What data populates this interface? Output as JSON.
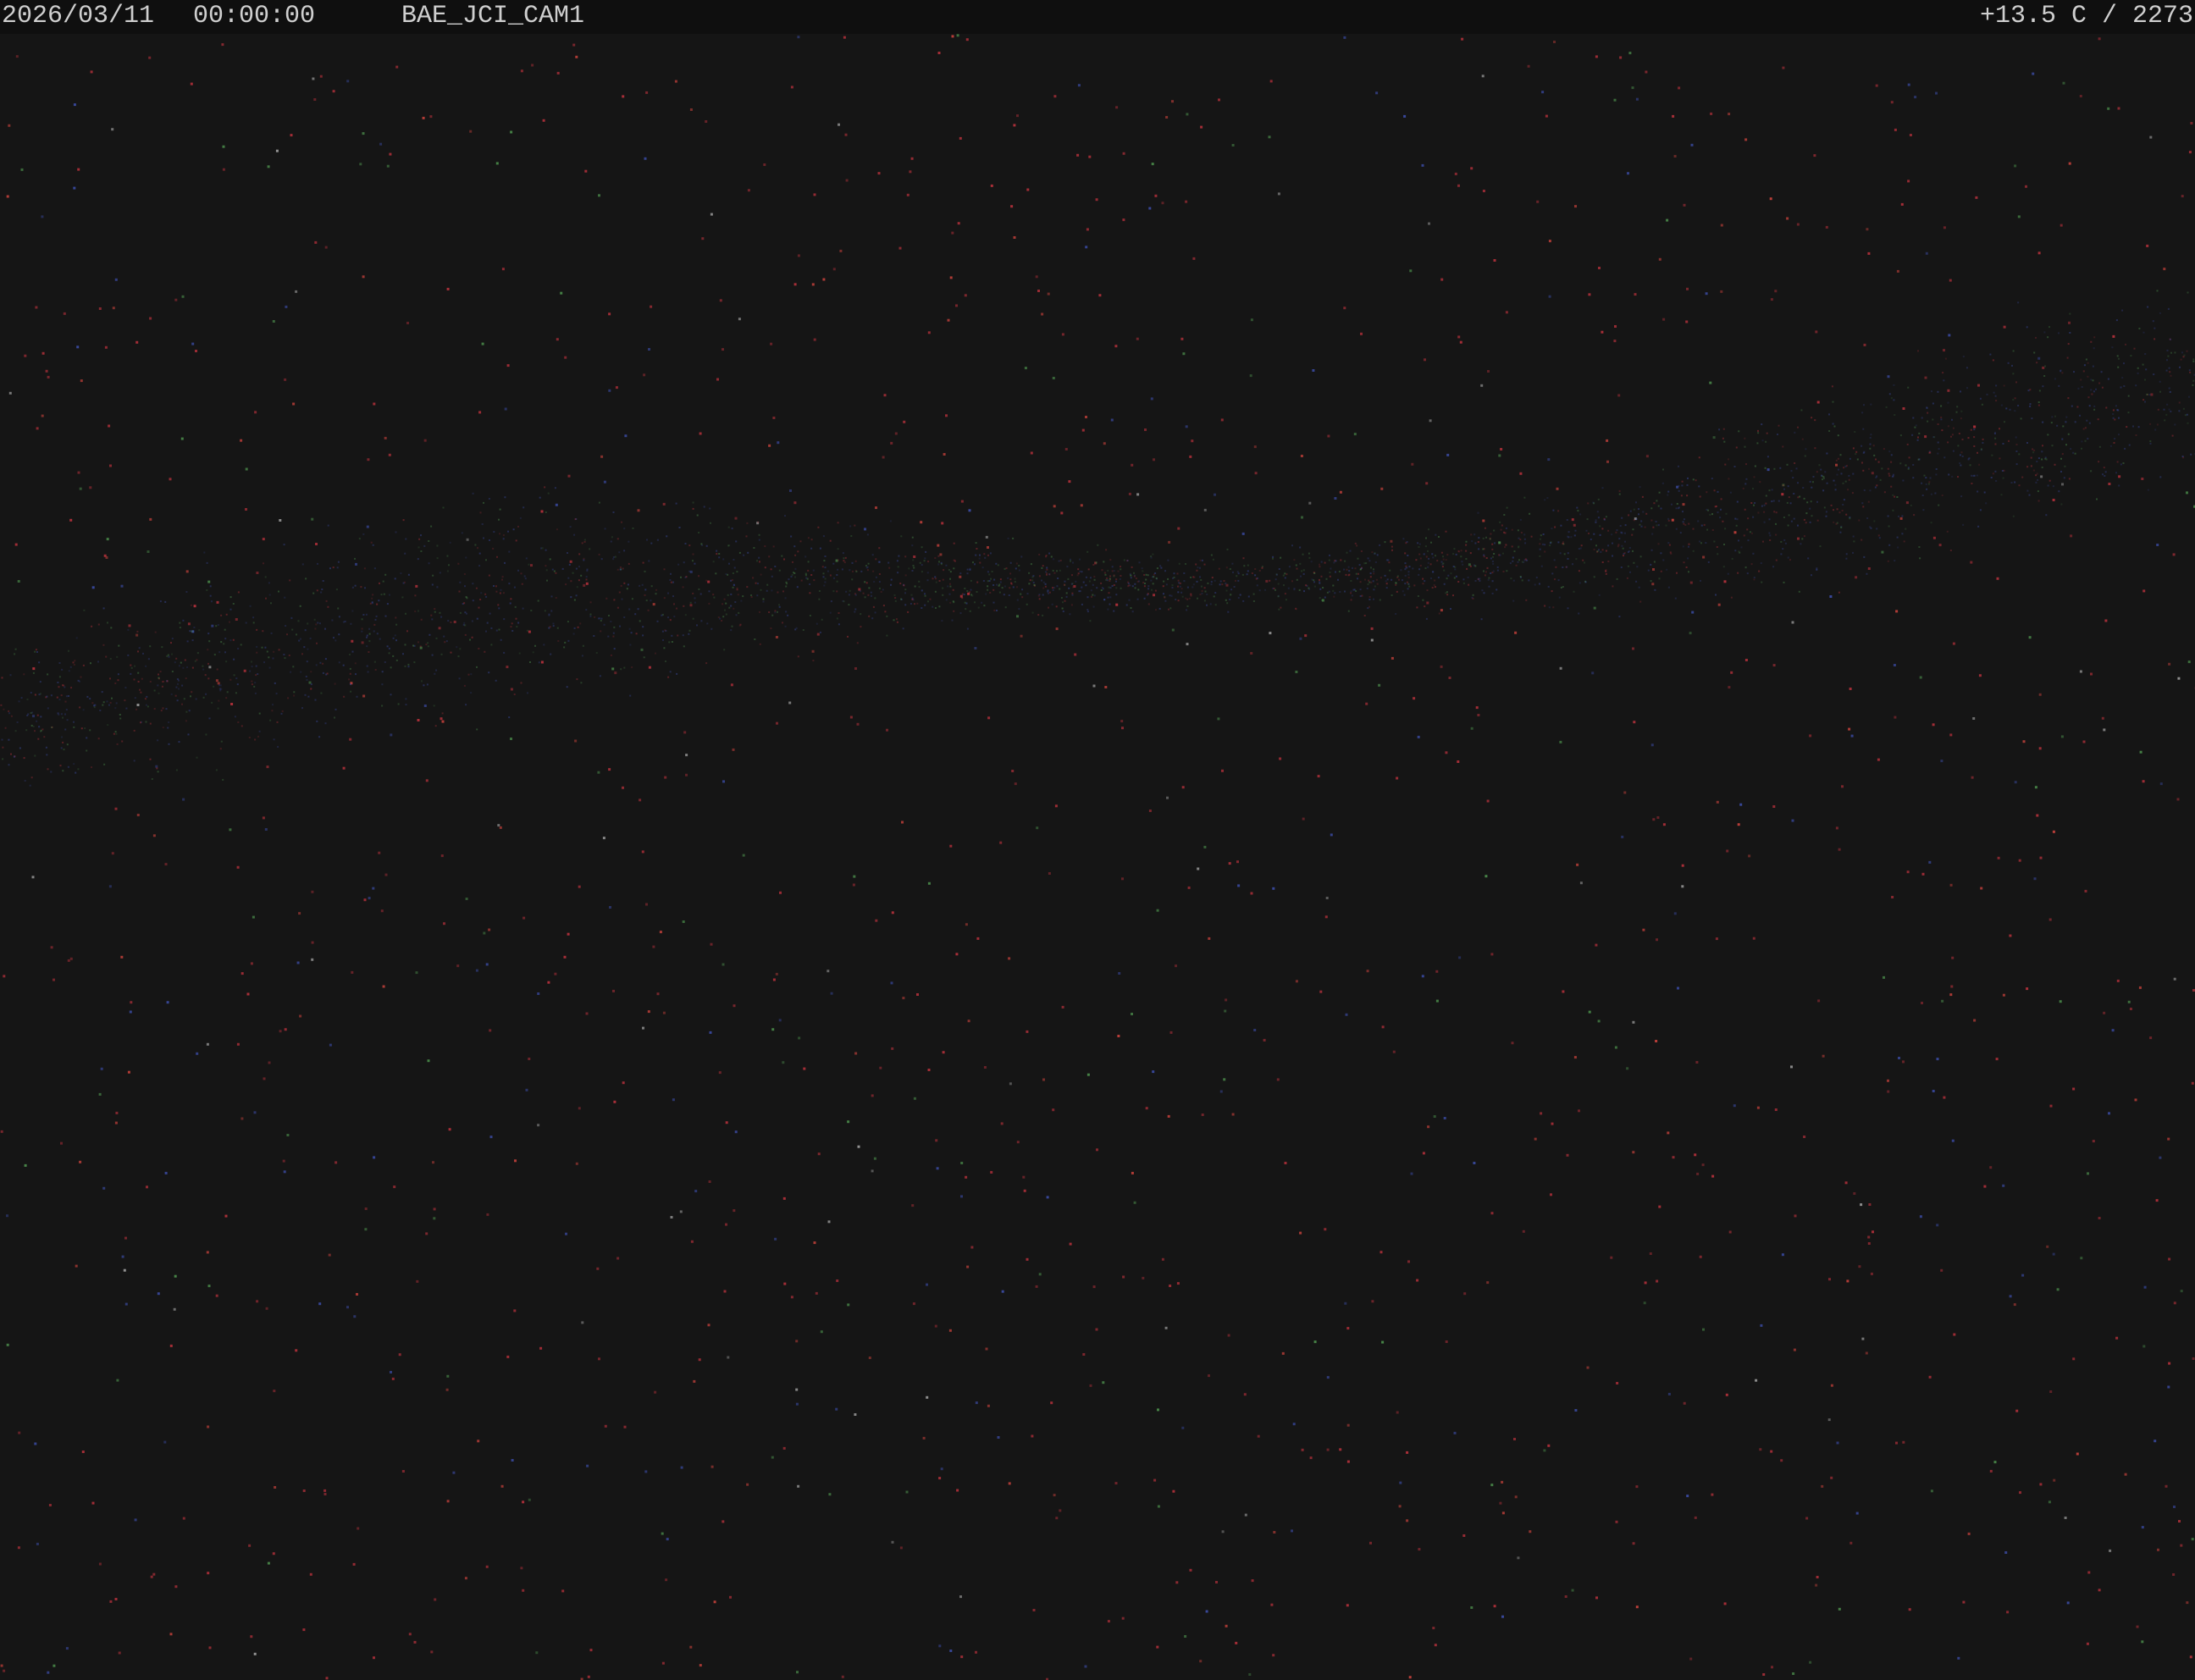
{
  "overlay": {
    "date": "2026/03/11",
    "time": "00:00:00",
    "camera_id": "BAE_JCI_CAM1",
    "temperature_reading": "+13.5 C / 2273"
  },
  "scene": {
    "description_type": "night-sky all-dark camera frame with sparse colored noise specks and a faint diagonal band",
    "background_color": "#151515",
    "overlay_text_color": "#cfcfcf",
    "speck_colors": [
      "#b0303a",
      "#c0403a",
      "#3a4aa0",
      "#4a8a4a",
      "#9a9a9a"
    ]
  }
}
